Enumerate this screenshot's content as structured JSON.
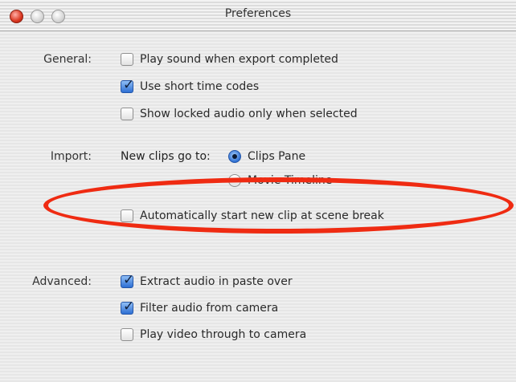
{
  "window": {
    "title": "Preferences"
  },
  "general": {
    "section_label": "General:",
    "options": [
      {
        "label": "Play sound when export completed",
        "checked": false
      },
      {
        "label": "Use short time codes",
        "checked": true
      },
      {
        "label": "Show locked audio only when selected",
        "checked": false
      }
    ]
  },
  "import": {
    "section_label": "Import:",
    "new_clips_label": "New clips go to:",
    "radio_options": [
      {
        "label": "Clips Pane",
        "selected": true
      },
      {
        "label": "Movie Timeline",
        "selected": false
      }
    ],
    "auto_start": {
      "label": "Automatically start new clip at scene break",
      "checked": false
    }
  },
  "advanced": {
    "section_label": "Advanced:",
    "options": [
      {
        "label": "Extract audio in paste over",
        "checked": true
      },
      {
        "label": "Filter audio from camera",
        "checked": true
      },
      {
        "label": "Play video through to camera",
        "checked": false
      }
    ]
  },
  "colors": {
    "highlight_ellipse": "#ef2b12",
    "checkbox_checked": "#2d6fd3"
  }
}
